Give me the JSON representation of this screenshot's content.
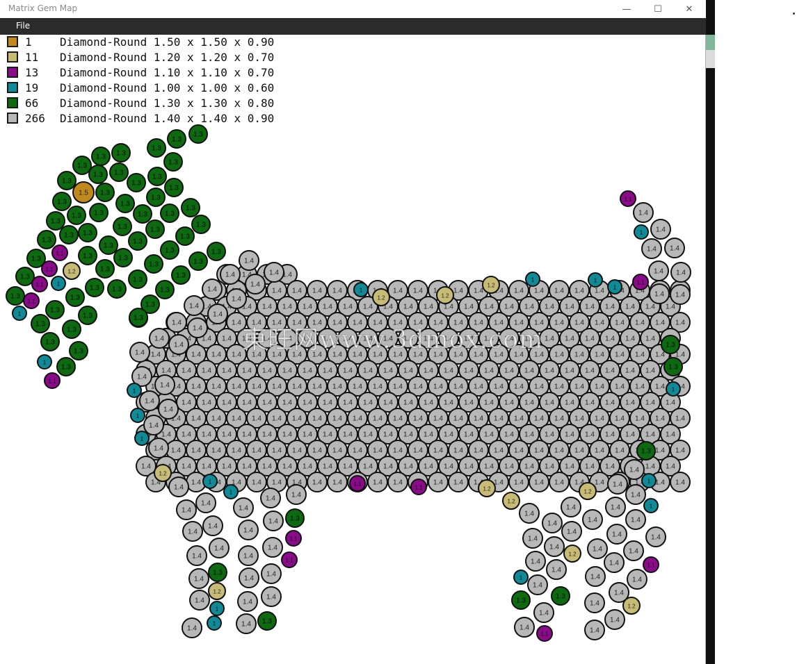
{
  "window": {
    "title": "Matrix Gem Map",
    "minimize_glyph": "—",
    "maximize_glyph": "☐",
    "close_glyph": "✕"
  },
  "menu": {
    "file_label": "File"
  },
  "legend": [
    {
      "count": "1",
      "color": "#c08a1e",
      "line": "Diamond-Round 1.50 x 1.50 x 0.90"
    },
    {
      "count": "11",
      "color": "#c8bb75",
      "line": "Diamond-Round 1.20 x 1.20 x 0.70"
    },
    {
      "count": "13",
      "color": "#8a0a8a",
      "line": "Diamond-Round 1.10 x 1.10 x 0.70"
    },
    {
      "count": "19",
      "color": "#0f8a96",
      "line": "Diamond-Round 1.00 x 1.00 x 0.60"
    },
    {
      "count": "66",
      "color": "#0d6a10",
      "line": "Diamond-Round 1.30 x 1.30 x 0.80"
    },
    {
      "count": "266",
      "color": "#b8b8b8",
      "line": "Diamond-Round 1.40 x 1.40 x 0.90"
    }
  ],
  "gem_types": {
    "1.5": {
      "color": "#c08a1e",
      "label": "1.5"
    },
    "1.2": {
      "color": "#c8bb75",
      "label": "1.2"
    },
    "1.1": {
      "color": "#8a0a8a",
      "label": "1.1"
    },
    "1.0": {
      "color": "#0f8a96",
      "label": "1"
    },
    "1.3": {
      "color": "#0d6a10",
      "label": "1.3"
    },
    "1.4": {
      "color": "#b8b8b8",
      "label": "1.4"
    }
  },
  "watermark": "東旺网www.3dmox.com"
}
